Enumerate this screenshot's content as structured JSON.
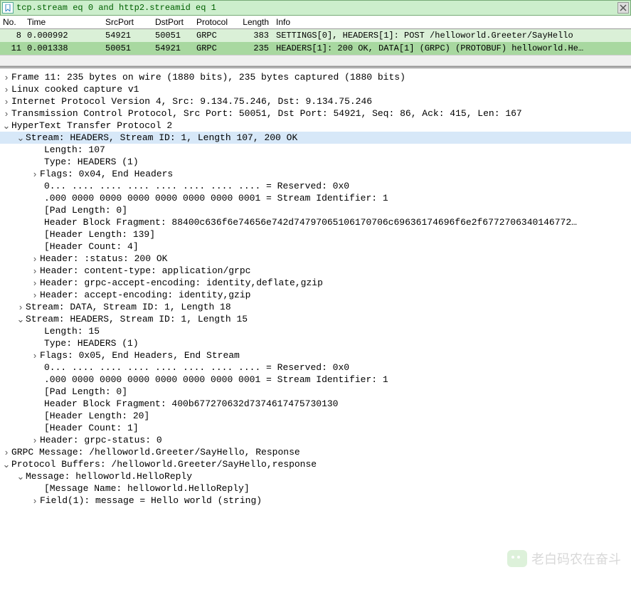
{
  "filter": "tcp.stream eq 0 and http2.streamid eq 1",
  "cols": {
    "no": "No.",
    "time": "Time",
    "src": "SrcPort",
    "dst": "DstPort",
    "proto": "Protocol",
    "len": "Length",
    "info": "Info"
  },
  "packets": [
    {
      "no": "8",
      "time": "0.000992",
      "src": "54921",
      "dst": "50051",
      "proto": "GRPC",
      "len": "383",
      "info": "SETTINGS[0], HEADERS[1]: POST /helloworld.Greeter/SayHello"
    },
    {
      "no": "11",
      "time": "0.001338",
      "src": "50051",
      "dst": "54921",
      "proto": "GRPC",
      "len": "235",
      "info": "HEADERS[1]: 200 OK, DATA[1] (GRPC) (PROTOBUF) helloworld.He…"
    }
  ],
  "d": {
    "frame": "Frame 11: 235 bytes on wire (1880 bits), 235 bytes captured (1880 bits)",
    "linux": "Linux cooked capture v1",
    "ip": "Internet Protocol Version 4, Src: 9.134.75.246, Dst: 9.134.75.246",
    "tcp": "Transmission Control Protocol, Src Port: 50051, Dst Port: 54921, Seq: 86, Ack: 415, Len: 167",
    "http2": "HyperText Transfer Protocol 2",
    "s1": "Stream: HEADERS, Stream ID: 1, Length 107, 200 OK",
    "s1_len": "Length: 107",
    "s1_type": "Type: HEADERS (1)",
    "s1_flags": "Flags: 0x04, End Headers",
    "s1_res": "0... .... .... .... .... .... .... .... = Reserved: 0x0",
    "s1_sid": ".000 0000 0000 0000 0000 0000 0000 0001 = Stream Identifier: 1",
    "s1_pad": "[Pad Length: 0]",
    "s1_hbf": "Header Block Fragment: 88400c636f6e74656e742d74797065106170706c69636174696f6e2f6772706340146772…",
    "s1_hlen": "[Header Length: 139]",
    "s1_hcnt": "[Header Count: 4]",
    "s1_h1": "Header: :status: 200 OK",
    "s1_h2": "Header: content-type: application/grpc",
    "s1_h3": "Header: grpc-accept-encoding: identity,deflate,gzip",
    "s1_h4": "Header: accept-encoding: identity,gzip",
    "s2": "Stream: DATA, Stream ID: 1, Length 18",
    "s3": "Stream: HEADERS, Stream ID: 1, Length 15",
    "s3_len": "Length: 15",
    "s3_type": "Type: HEADERS (1)",
    "s3_flags": "Flags: 0x05, End Headers, End Stream",
    "s3_res": "0... .... .... .... .... .... .... .... = Reserved: 0x0",
    "s3_sid": ".000 0000 0000 0000 0000 0000 0000 0001 = Stream Identifier: 1",
    "s3_pad": "[Pad Length: 0]",
    "s3_hbf": "Header Block Fragment: 400b677270632d7374617475730130",
    "s3_hlen": "[Header Length: 20]",
    "s3_hcnt": "[Header Count: 1]",
    "s3_h1": "Header: grpc-status: 0",
    "grpc": "GRPC Message: /helloworld.Greeter/SayHello, Response",
    "pb": "Protocol Buffers: /helloworld.Greeter/SayHello,response",
    "msg": "Message: helloworld.HelloReply",
    "msgname": "[Message Name: helloworld.HelloReply]",
    "field": "Field(1): message = Hello world (string)"
  },
  "watermark": "老白码农在奋斗"
}
